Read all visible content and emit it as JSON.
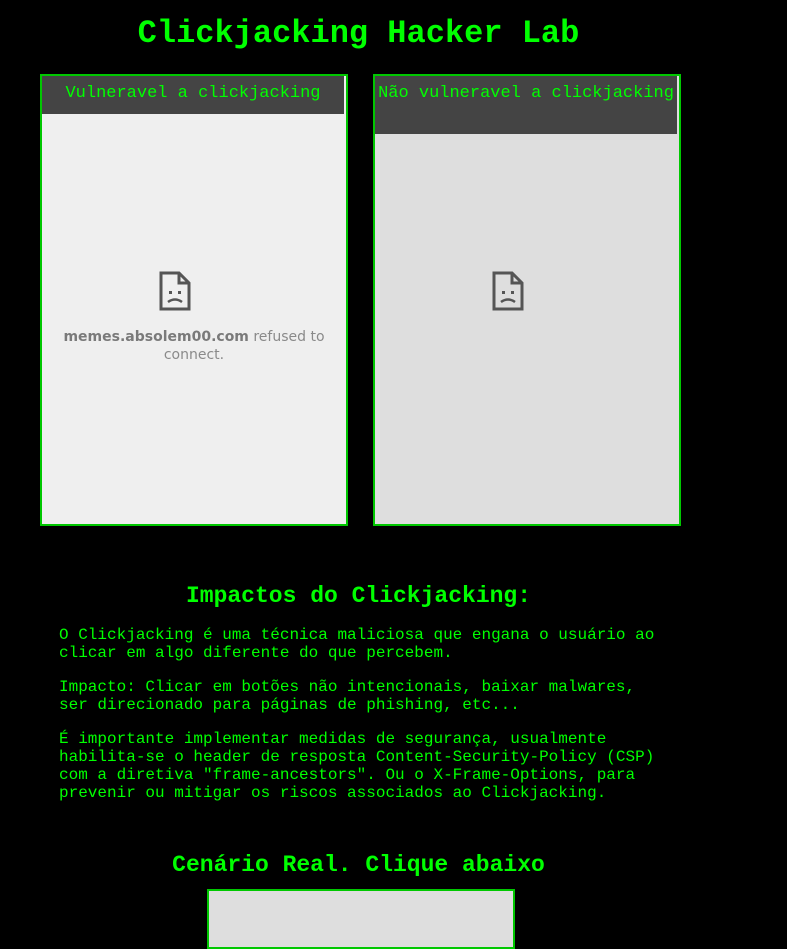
{
  "page": {
    "title": "Clickjacking Hacker Lab"
  },
  "frames": {
    "vulnerable": {
      "header": "Vulneravel a clickjacking",
      "icon": "sad-document-icon",
      "refused_host": "memes.absolem00.com",
      "refused_text": " refused to connect."
    },
    "safe": {
      "header": "Não vulneravel a clickjacking",
      "icon": "sad-document-icon"
    }
  },
  "impacts": {
    "title": "Impactos do Clickjacking:",
    "paragraphs": [
      "O Clickjacking é uma técnica maliciosa que engana o usuário ao\nclicar em algo diferente do que percebem.",
      "Impacto: Clicar em botões não intencionais, baixar malwares,\nser direcionado para páginas de phishing, etc...",
      "É importante implementar medidas de segurança, usualmente\nhabilita-se o header de resposta Content-Security-Policy (CSP)\ncom a diretiva \"frame-ancestors\". Ou o X-Frame-Options, para\nprevenir ou mitigar os riscos associados ao Clickjacking."
    ]
  },
  "scenario": {
    "title": "Cenário Real. Clique abaixo"
  },
  "colors": {
    "background": "#000000",
    "accent": "#00ff00",
    "frame_border": "#00c800",
    "header_bg": "#444444"
  }
}
